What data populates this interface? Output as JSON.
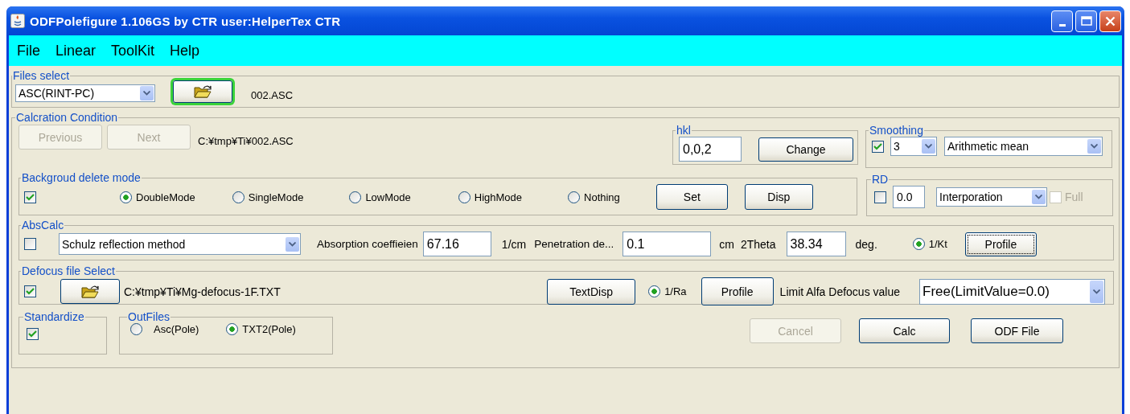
{
  "window": {
    "title": "ODFPolefigure 1.106GS by CTR  user:HelperTex CTR"
  },
  "menu": [
    "File",
    "Linear",
    "ToolKit",
    "Help"
  ],
  "files_select": {
    "title": "Files select",
    "format": "ASC(RINT-PC)",
    "open_focused": true,
    "file": "002.ASC"
  },
  "calc_condition": {
    "title": "Calcration Condition",
    "previous": {
      "label": "Previous",
      "disabled": true
    },
    "next": {
      "label": "Next",
      "disabled": true
    },
    "path": "C:¥tmp¥Ti¥002.ASC",
    "hkl": {
      "title": "hkl",
      "value": "0,0,2",
      "button": "Change"
    },
    "smoothing": {
      "title": "Smoothing",
      "checked": true,
      "size": "3",
      "method": "Arithmetic mean"
    },
    "background": {
      "title": "Backgroud delete mode",
      "checked": true,
      "modes": [
        {
          "label": "DoubleMode",
          "selected": true
        },
        {
          "label": "SingleMode",
          "selected": false
        },
        {
          "label": "LowMode",
          "selected": false
        },
        {
          "label": "HighMode",
          "selected": false
        },
        {
          "label": "Nothing",
          "selected": false
        }
      ],
      "buttons": [
        "Set",
        "Disp"
      ]
    },
    "rd": {
      "title": "RD",
      "checked": false,
      "value": "0.0",
      "method": "Interporation",
      "full": {
        "label": "Full",
        "checked": false,
        "disabled": true
      }
    },
    "abs_calc": {
      "title": "AbsCalc",
      "checked": false,
      "method": "Schulz reflection method",
      "absorption_label": "Absorption coeffieien",
      "absorption": "67.16",
      "absorption_unit": "1/cm",
      "penetration_label": "Penetration de...",
      "penetration": "0.1",
      "penetration_unit": "cm",
      "theta_label": "2Theta",
      "theta": "38.34",
      "theta_unit": "deg.",
      "kt": {
        "label": "1/Kt",
        "selected": true
      },
      "profile": {
        "label": "Profile",
        "focused": true
      }
    },
    "defocus": {
      "title": "Defocus file Select",
      "checked": true,
      "path": "C:¥tmp¥Ti¥Mg-defocus-1F.TXT",
      "text_disp": "TextDisp",
      "ra": {
        "label": "1/Ra",
        "selected": true
      },
      "profile": "Profile",
      "limit_label": "Limit Alfa Defocus value",
      "limit": "Free(LimitValue=0.0)"
    },
    "standardize": {
      "title": "Standardize",
      "checked": true
    },
    "out_files": {
      "title": "OutFiles",
      "options": [
        {
          "label": "Asc(Pole)",
          "selected": false
        },
        {
          "label": "TXT2(Pole)",
          "selected": true
        }
      ]
    },
    "actions": [
      {
        "label": "Cancel",
        "disabled": true
      },
      {
        "label": "Calc",
        "disabled": false
      },
      {
        "label": "ODF File",
        "disabled": false
      }
    ]
  }
}
